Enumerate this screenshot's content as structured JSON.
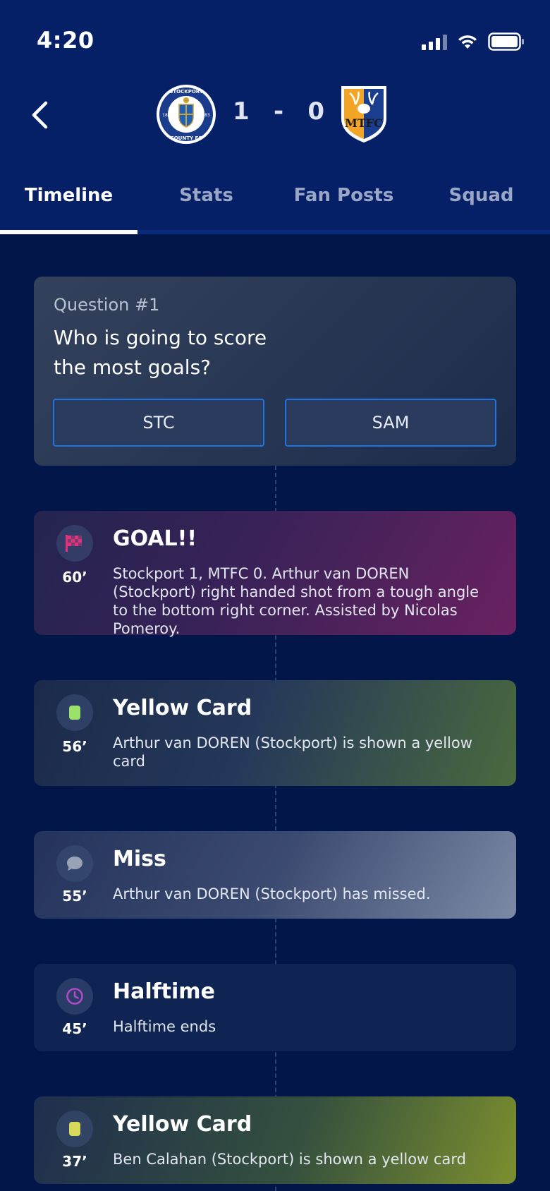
{
  "status_bar": {
    "time": "4:20"
  },
  "match": {
    "home_crest_text": "STOCKPORT COUNTY FC",
    "home_score": "1",
    "separator": "-",
    "away_score": "0",
    "away_crest_text": "MTFC"
  },
  "tabs": [
    {
      "label": "Timeline",
      "active": true
    },
    {
      "label": "Stats",
      "active": false
    },
    {
      "label": "Fan Posts",
      "active": false
    },
    {
      "label": "Squad",
      "active": false
    }
  ],
  "question": {
    "number": "Question #1",
    "text": "Who is going to score the most goals?",
    "options": [
      "STC",
      "SAM"
    ]
  },
  "events": [
    {
      "type": "goal",
      "icon": "checkered-flag-icon",
      "minute": "60’",
      "title": "GOAL!!",
      "description": "Stockport 1, MTFC 0. Arthur van DOREN (Stockport) right handed shot from a tough angle to the bottom right corner. Assisted by Nicolas Pomeroy."
    },
    {
      "type": "yellow-card",
      "icon": "card-icon",
      "minute": "56’",
      "title": "Yellow Card",
      "description": "Arthur van DOREN (Stockport) is shown a yellow card"
    },
    {
      "type": "miss",
      "icon": "chat-bubble-icon",
      "minute": "55’",
      "title": "Miss",
      "description": "Arthur van DOREN (Stockport) has missed."
    },
    {
      "type": "halftime",
      "icon": "clock-icon",
      "minute": "45’",
      "title": "Halftime",
      "description": "Halftime ends"
    },
    {
      "type": "yellow-card",
      "icon": "card-icon",
      "minute": "37’",
      "title": "Yellow Card",
      "description": "Ben Calahan (Stockport) is shown a yellow card"
    }
  ],
  "colors": {
    "background": "#03164a",
    "header": "#052066",
    "goal_accent": "#e0347a",
    "yellow_card_green": "#9be26a",
    "yellow_card_yellow": "#d8d85a",
    "clock_purple": "#b04ac9",
    "option_border": "#1f74e0"
  }
}
